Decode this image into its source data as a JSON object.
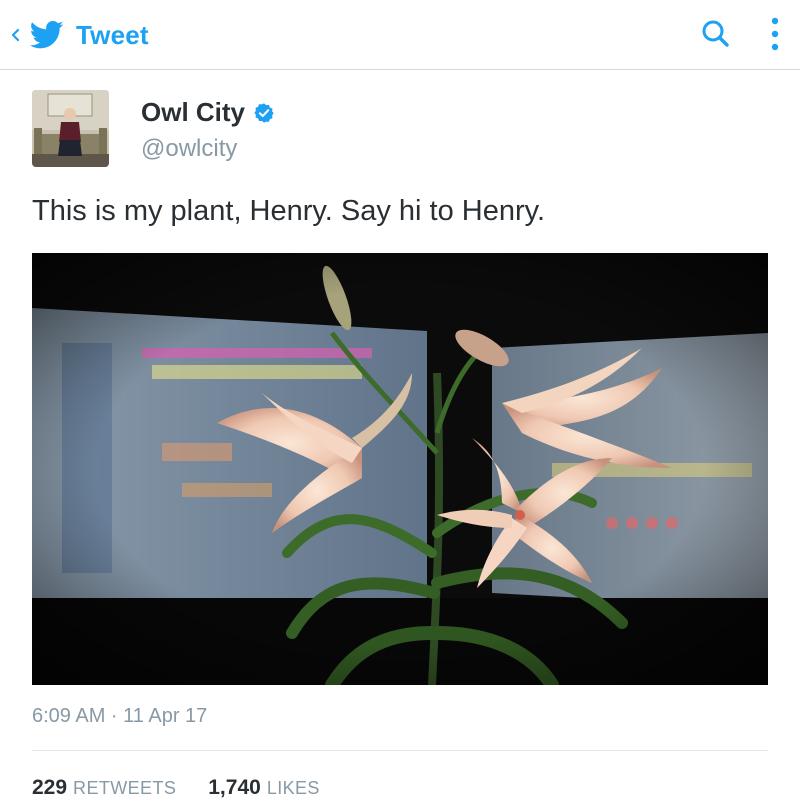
{
  "header": {
    "title": "Tweet",
    "back_icon": "chevron-left-icon",
    "logo_icon": "twitter-bird-icon",
    "search_icon": "search-icon",
    "menu_icon": "more-vertical-icon",
    "accent_color": "#1da1f2"
  },
  "tweet": {
    "author": {
      "name": "Owl City",
      "handle": "@owlcity",
      "verified": true,
      "verified_icon": "verified-badge-icon"
    },
    "text": "This is my plant, Henry. Say hi to Henry.",
    "timestamp": "6:09 AM · 11 Apr 17",
    "stats": {
      "retweets_count": "229",
      "retweets_label": "RETWEETS",
      "likes_count": "1,740",
      "likes_label": "LIKES"
    }
  }
}
